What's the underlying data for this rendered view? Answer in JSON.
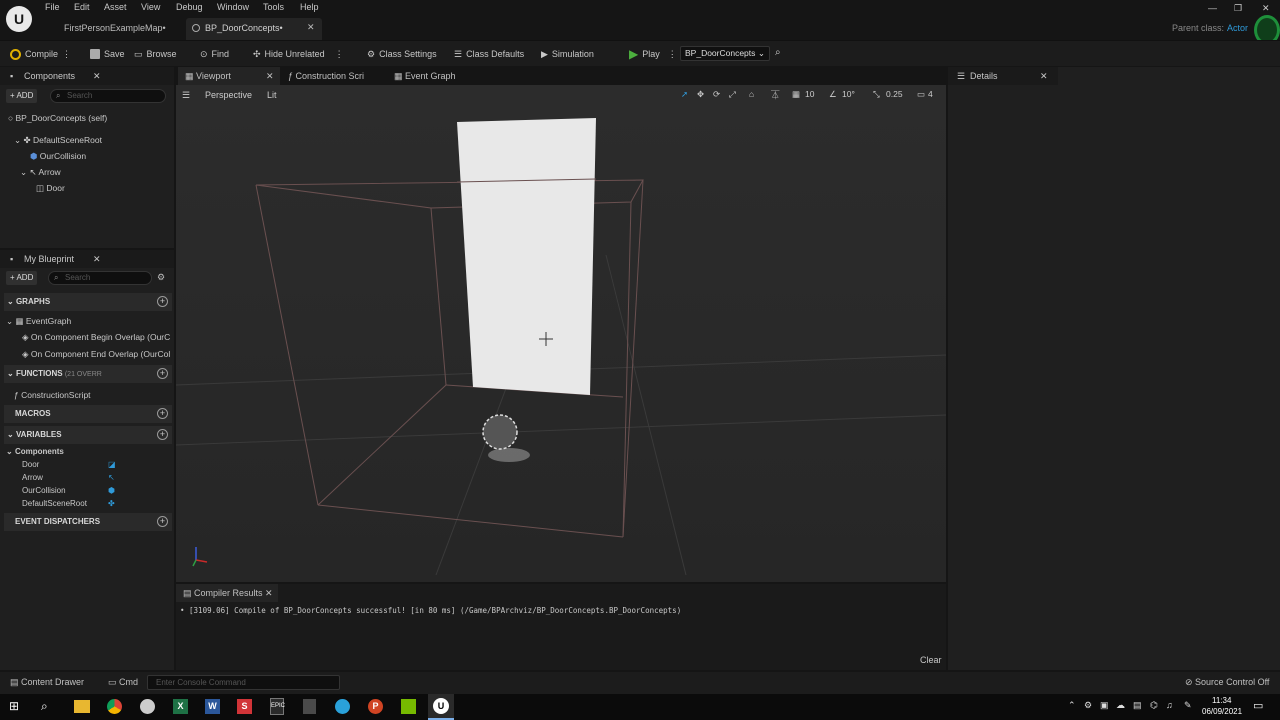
{
  "window": {
    "menu": [
      "File",
      "Edit",
      "View",
      "Debug",
      "Asset",
      "Window",
      "Tools",
      "Help"
    ],
    "tabs": [
      "FirstPersonExampleMap•",
      "BP_DoorConcepts•"
    ],
    "parent_class_label": "Parent class:",
    "parent_class_value": "Actor"
  },
  "toolbar": {
    "compile": "Compile",
    "save": "Save",
    "browse": "Browse",
    "find": "Find",
    "hide_unrelated": "Hide Unrelated",
    "class_settings": "Class Settings",
    "class_defaults": "Class Defaults",
    "simulation": "Simulation",
    "play": "Play",
    "debug_object": "BP_DoorConcepts"
  },
  "components": {
    "title": "Components",
    "add": "ADD",
    "search_placeholder": "Search",
    "tree": [
      "BP_DoorConcepts (self)",
      "DefaultSceneRoot",
      "OurCollision",
      "Arrow",
      "Door"
    ]
  },
  "myblueprint": {
    "title": "My Blueprint",
    "add": "ADD",
    "search_placeholder": "Search",
    "graphs_header": "GRAPHS",
    "graphs": [
      "EventGraph",
      "On Component Begin Overlap (OurC",
      "On Component End Overlap (OurCol"
    ],
    "functions_header": "FUNCTIONS",
    "functions_count": "(21 OVERR",
    "functions": [
      "ConstructionScript"
    ],
    "macros_header": "MACROS",
    "variables_header": "VARIABLES",
    "components_group": "Components",
    "variables": [
      "Door",
      "Arrow",
      "OurCollision",
      "DefaultSceneRoot"
    ],
    "dispatchers_header": "EVENT DISPATCHERS"
  },
  "editor_tabs": [
    "Viewport",
    "Construction Scri",
    "Event Graph"
  ],
  "viewport": {
    "perspective": "Perspective",
    "lit": "Lit",
    "grid_snap": "10",
    "rot_snap": "10°",
    "scale_snap": "0.25",
    "camera_speed": "4"
  },
  "details": {
    "title": "Details"
  },
  "compiler": {
    "title": "Compiler Results",
    "message": "[3109.06] Compile of BP_DoorConcepts successful! [in 80 ms] (/Game/BPArchviz/BP_DoorConcepts.BP_DoorConcepts)",
    "clear": "Clear"
  },
  "statusbar": {
    "content_drawer": "Content Drawer",
    "cmd": "Cmd",
    "console_placeholder": "Enter Console Command",
    "source_control": "Source Control Off"
  },
  "taskbar": {
    "time": "11:34",
    "date": "06/09/2021"
  }
}
